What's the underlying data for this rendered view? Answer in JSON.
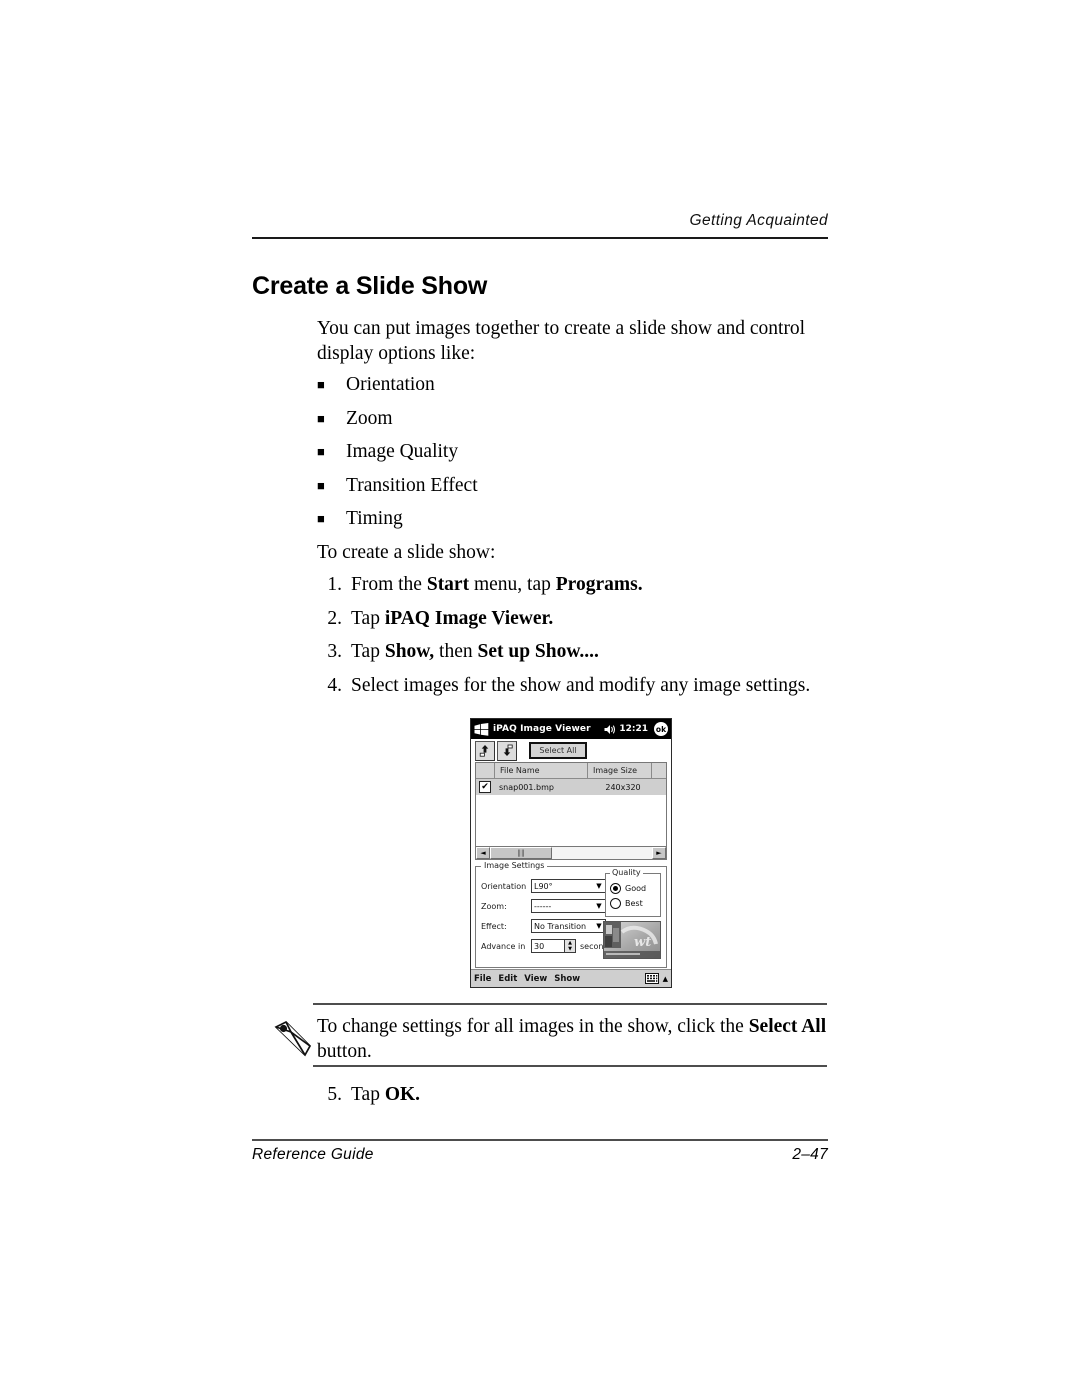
{
  "header": {
    "running_head": "Getting Acquainted"
  },
  "section": {
    "title": "Create a Slide Show"
  },
  "intro": "You can put images together to create a slide show and control display options like:",
  "bullets": [
    {
      "mark": "■",
      "label": "Orientation"
    },
    {
      "mark": "■",
      "label": "Zoom"
    },
    {
      "mark": "■",
      "label": "Image Quality"
    },
    {
      "mark": "■",
      "label": "Transition Effect"
    },
    {
      "mark": "■",
      "label": "Timing"
    }
  ],
  "to_create": "To create a slide show:",
  "steps": [
    {
      "num": "1.",
      "parts": [
        {
          "t": "From the ",
          "b": false
        },
        {
          "t": "Start",
          "b": true
        },
        {
          "t": " menu, tap ",
          "b": false
        },
        {
          "t": "Programs.",
          "b": true
        }
      ]
    },
    {
      "num": "2.",
      "parts": [
        {
          "t": "Tap ",
          "b": false
        },
        {
          "t": "iPAQ Image Viewer.",
          "b": true
        }
      ]
    },
    {
      "num": "3.",
      "parts": [
        {
          "t": "Tap ",
          "b": false
        },
        {
          "t": "Show,",
          "b": true
        },
        {
          "t": " then ",
          "b": false
        },
        {
          "t": "Set up Show....",
          "b": true
        }
      ]
    },
    {
      "num": "4.",
      "parts": [
        {
          "t": "Select images for the show and modify any image settings.",
          "b": false
        }
      ]
    }
  ],
  "step5": {
    "num": "5.",
    "parts": [
      {
        "t": "Tap ",
        "b": false
      },
      {
        "t": "OK.",
        "b": true
      }
    ]
  },
  "note": {
    "icon": "pencil-icon",
    "parts": [
      {
        "t": "To change settings for all images in the show, click the ",
        "b": false
      },
      {
        "t": "Select All",
        "b": true
      },
      {
        "t": " button.",
        "b": false
      }
    ]
  },
  "footer": {
    "left": "Reference Guide",
    "right": "2–47"
  },
  "pda": {
    "titlebar": {
      "logo_icon": "windows-logo-icon",
      "title": "iPAQ Image Viewer",
      "speaker_icon": "speaker-icon",
      "clock": "12:21",
      "ok_label": "ok"
    },
    "toolbar": {
      "up_icon": "folder-up-icon",
      "down_icon": "folder-down-icon",
      "select_all_label": "Select All"
    },
    "list": {
      "columns": [
        "",
        "File Name",
        "Image Size",
        ""
      ],
      "rows": [
        {
          "checked": true,
          "check_mark": "✔",
          "file_name": "snap001.bmp",
          "image_size": "240x320"
        }
      ]
    },
    "scrollbar": {
      "left_arrow": "◄",
      "right_arrow": "►",
      "grip": "‖‖"
    },
    "settings": {
      "legend": "Image Settings",
      "rows": [
        {
          "label": "Orientation",
          "value": "L90°",
          "arrow": "▼"
        },
        {
          "label": "Zoom:",
          "value": "------",
          "arrow": "▼"
        },
        {
          "label": "Effect:",
          "value": "No Transition",
          "arrow": "▼"
        }
      ],
      "advance": {
        "label": "Advance in",
        "value": "30",
        "unit": "seconds",
        "up": "▲",
        "down": "▼"
      }
    },
    "quality": {
      "legend": "Quality",
      "options": [
        {
          "label": "Good",
          "selected": true
        },
        {
          "label": "Best",
          "selected": false
        }
      ]
    },
    "preview": {
      "alt": "image-thumbnail"
    },
    "menubar": {
      "items": [
        "File",
        "Edit",
        "View",
        "Show"
      ],
      "keyboard_icon": "keyboard-icon",
      "up_arrow": "▲"
    }
  }
}
